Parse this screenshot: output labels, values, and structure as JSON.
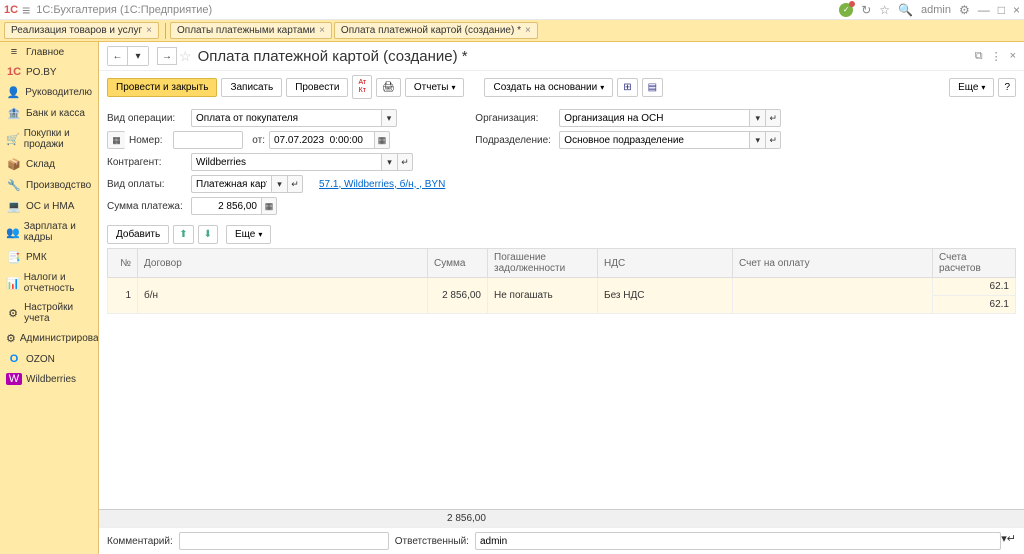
{
  "titlebar": {
    "logo": "1C",
    "menu": "≡",
    "title": "1С:Бухгалтерия  (1С:Предприятие)",
    "user": "admin"
  },
  "tabs": [
    {
      "label": "Реализация товаров и услуг"
    },
    {
      "label": "Оплаты платежными картами"
    },
    {
      "label": "Оплата платежной картой (создание) *"
    }
  ],
  "sidebar": {
    "items": [
      {
        "icon": "≡",
        "label": "Главное"
      },
      {
        "icon": "1С",
        "label": "PO.BY",
        "color": "#d9534f"
      },
      {
        "icon": "👤",
        "label": "Руководителю"
      },
      {
        "icon": "🏦",
        "label": "Банк и касса"
      },
      {
        "icon": "🛒",
        "label": "Покупки и продажи"
      },
      {
        "icon": "📦",
        "label": "Склад"
      },
      {
        "icon": "🔧",
        "label": "Производство"
      },
      {
        "icon": "💻",
        "label": "ОС и НМА"
      },
      {
        "icon": "👥",
        "label": "Зарплата и кадры"
      },
      {
        "icon": "📑",
        "label": "РМК"
      },
      {
        "icon": "📊",
        "label": "Налоги и отчетность"
      },
      {
        "icon": "⚙",
        "label": "Настройки учета"
      },
      {
        "icon": "⚙",
        "label": "Администрирование"
      },
      {
        "icon": "O",
        "label": "OZON",
        "color": "#0088ff"
      },
      {
        "icon": "W",
        "label": "Wildberries",
        "color": "#b000b0"
      }
    ]
  },
  "page": {
    "title": "Оплата платежной картой (создание) *",
    "toolbar": {
      "post_close": "Провести и закрыть",
      "save": "Записать",
      "post": "Провести",
      "dt_kt": "Дт\nКт",
      "reports": "Отчеты",
      "create_based": "Создать на основании",
      "more": "Еще"
    },
    "form": {
      "op_type_label": "Вид операции:",
      "op_type_value": "Оплата от покупателя",
      "number_label": "Номер:",
      "number_value": "",
      "from_label": "от:",
      "date_value": "07.07.2023  0:00:00",
      "counterparty_label": "Контрагент:",
      "counterparty_value": "Wildberries",
      "payment_type_label": "Вид оплаты:",
      "payment_type_value": "Платежная карта",
      "payment_link": "57.1, Wildberries, б/н, , BYN",
      "sum_label": "Сумма платежа:",
      "sum_value": "2 856,00",
      "org_label": "Организация:",
      "org_value": "Организация на ОСН",
      "division_label": "Подразделение:",
      "division_value": "Основное подразделение"
    },
    "table_toolbar": {
      "add": "Добавить",
      "more": "Еще"
    },
    "table": {
      "headers": {
        "num": "№",
        "contract": "Договор",
        "sum": "Сумма",
        "repay": "Погашение задолженности",
        "vat": "НДС",
        "invoice": "Счет на оплату",
        "accounts": "Счета расчетов"
      },
      "rows": [
        {
          "num": "1",
          "contract": "б/н",
          "sum": "2 856,00",
          "repay": "Не погашать",
          "vat": "Без НДС",
          "invoice": "",
          "account1": "62.1",
          "account2": "62.1"
        }
      ],
      "total_sum": "2 856,00"
    },
    "footer": {
      "comment_label": "Комментарий:",
      "comment_value": "",
      "responsible_label": "Ответственный:",
      "responsible_value": "admin"
    }
  }
}
